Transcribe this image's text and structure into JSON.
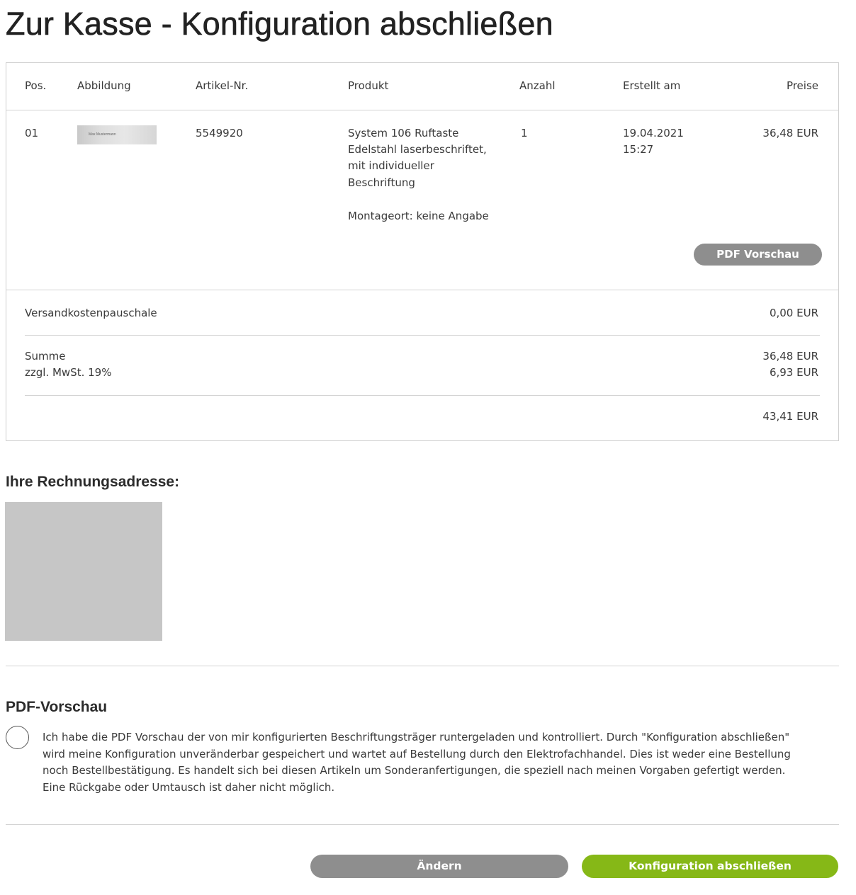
{
  "page": {
    "title": "Zur Kasse - Konfiguration abschließen"
  },
  "cart": {
    "headers": {
      "pos": "Pos.",
      "image": "Abbildung",
      "article_no": "Artikel-Nr.",
      "product": "Produkt",
      "quantity": "Anzahl",
      "created": "Erstellt am",
      "price": "Preise"
    },
    "item": {
      "pos": "01",
      "thumbnail_text": "Max Mustermann",
      "article_no": "5549920",
      "product_lines": [
        "System 106 Ruftaste",
        "Edelstahl laserbeschriftet,",
        "mit individueller",
        "Beschriftung"
      ],
      "mounting": "Montageort: keine Angabe",
      "quantity": "1",
      "created_date": "19.04.2021",
      "created_time": "15:27",
      "price": "36,48 EUR",
      "pdf_button": "PDF Vorschau"
    },
    "shipping": {
      "label": "Versandkostenpauschale",
      "value": "0,00 EUR"
    },
    "sum": {
      "label": "Summe",
      "value": "36,48 EUR"
    },
    "vat": {
      "label": "zzgl. MwSt. 19%",
      "value": "6,93 EUR"
    },
    "total": {
      "value": "43,41 EUR"
    }
  },
  "address": {
    "heading": "Ihre Rechnungsadresse:"
  },
  "pdf_preview": {
    "heading": "PDF-Vorschau",
    "consent_lines": [
      "Ich habe die PDF Vorschau der von mir konfigurierten Beschriftungsträger runtergeladen und kontrolliert. Durch \"Konfiguration abschließen\"",
      "wird meine Konfiguration unveränderbar gespeichert und wartet auf Bestellung durch den Elektrofachhandel. Dies ist weder eine Bestellung",
      "noch Bestellbestätigung. Es handelt sich bei diesen Artikeln um Sonderanfertigungen, die speziell nach meinen Vorgaben gefertigt werden.",
      "Eine Rückgabe oder Umtausch ist daher nicht möglich."
    ]
  },
  "actions": {
    "change_label": "Ändern",
    "finish_label": "Konfiguration abschließen"
  },
  "colors": {
    "accent_green": "#86b817",
    "button_gray": "#8e8e8e",
    "placeholder_gray": "#c6c6c6"
  }
}
